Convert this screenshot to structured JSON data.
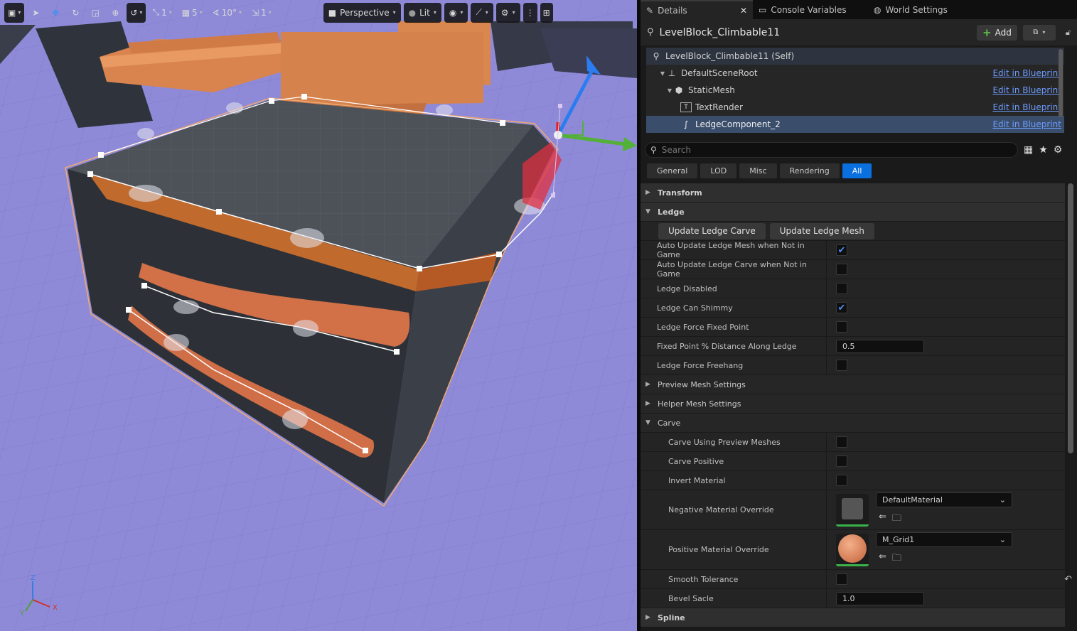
{
  "viewport": {
    "toolbar": {
      "perspective_label": "Perspective",
      "lit_label": "Lit",
      "snap_translate_value": "1",
      "grid_snap_value": "5",
      "rotation_snap_value": "10°",
      "scale_snap_value": "1"
    },
    "axis": {
      "x": "X",
      "y": "Y",
      "z": "Z"
    }
  },
  "panel": {
    "tabs": [
      {
        "label": "Details"
      },
      {
        "label": "Console Variables"
      },
      {
        "label": "World Settings"
      }
    ],
    "actor_name": "LevelBlock_Climbable11",
    "add_label": "Add",
    "components": [
      {
        "label": "LevelBlock_Climbable11 (Self)",
        "link": ""
      },
      {
        "label": "DefaultSceneRoot",
        "link": "Edit in Blueprint"
      },
      {
        "label": "StaticMesh",
        "link": "Edit in Blueprint"
      },
      {
        "label": "TextRender",
        "link": "Edit in Blueprint"
      },
      {
        "label": "LedgeComponent_2",
        "link": "Edit in Blueprint"
      }
    ],
    "search_placeholder": "Search",
    "filters": [
      {
        "label": "General"
      },
      {
        "label": "LOD"
      },
      {
        "label": "Misc"
      },
      {
        "label": "Rendering"
      },
      {
        "label": "All"
      }
    ],
    "categories": {
      "transform": "Transform",
      "ledge": "Ledge",
      "preview_mesh": "Preview Mesh Settings",
      "helper_mesh": "Helper Mesh Settings",
      "carve": "Carve",
      "spline": "Spline"
    },
    "ledge_buttons": {
      "update_carve": "Update Ledge Carve",
      "update_mesh": "Update Ledge Mesh"
    },
    "ledge_props": [
      {
        "label": "Auto Update Ledge Mesh when Not in Game",
        "checked": "✔"
      },
      {
        "label": "Auto Update Ledge Carve when Not in Game",
        "checked": ""
      },
      {
        "label": "Ledge Disabled",
        "checked": ""
      },
      {
        "label": "Ledge Can Shimmy",
        "checked": "✔"
      },
      {
        "label": "Ledge Force Fixed Point",
        "checked": ""
      },
      {
        "label": "Fixed Point % Distance Along Ledge",
        "value": "0.5"
      },
      {
        "label": "Ledge Force Freehang",
        "checked": ""
      }
    ],
    "carve_props": [
      {
        "label": "Carve Using Preview Meshes",
        "checked": ""
      },
      {
        "label": "Carve Positive",
        "checked": ""
      },
      {
        "label": "Invert Material",
        "checked": ""
      }
    ],
    "materials": [
      {
        "label": "Negative Material Override",
        "value": "DefaultMaterial"
      },
      {
        "label": "Positive Material Override",
        "value": "M_Grid1"
      }
    ],
    "carve_extra": [
      {
        "label": "Smooth Tolerance",
        "checked": ""
      },
      {
        "label": "Bevel Sacle",
        "value": "1.0"
      }
    ]
  }
}
